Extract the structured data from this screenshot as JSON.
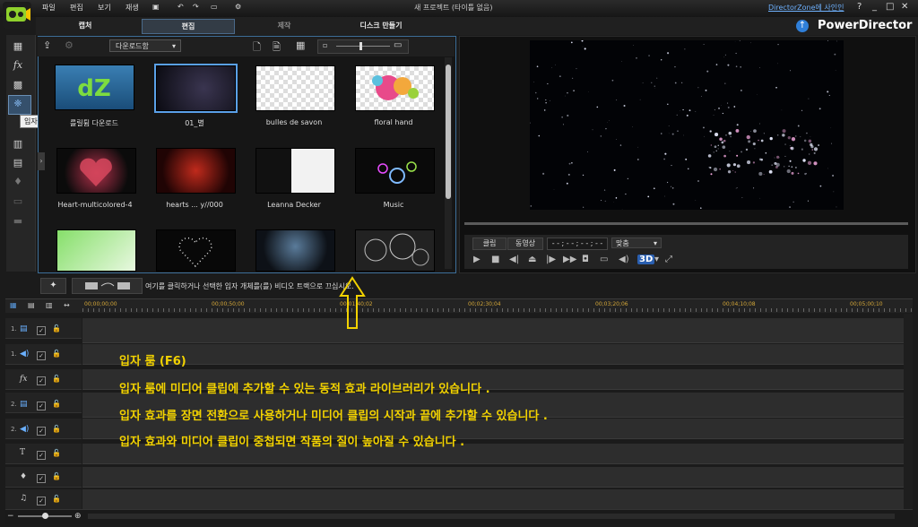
{
  "title_bar": {
    "menu": [
      "파일",
      "편집",
      "보기",
      "재생"
    ],
    "title": "새 프로젝트 (타이틀 없음)",
    "directorzone_link": "DirectorZone에 사인인",
    "help": "?",
    "minimize": "_",
    "restore": "□",
    "close": "✕"
  },
  "mode_tabs": [
    {
      "label": "캡처"
    },
    {
      "label": "편집"
    },
    {
      "label": "제작"
    },
    {
      "label": "디스크 만들기"
    }
  ],
  "brand": "PowerDirector",
  "tooltip": "입자 룸 (F6)",
  "library": {
    "dropdown_value": "다운로드함",
    "items": [
      {
        "label": "를릴튐 다운로드"
      },
      {
        "label": "01_별"
      },
      {
        "label": "bulles de savon"
      },
      {
        "label": "floral hand"
      },
      {
        "label": "Heart-multicolored-4"
      },
      {
        "label": "hearts ... y//000"
      },
      {
        "label": "Leanna Decker"
      },
      {
        "label": "Music"
      },
      {
        "label": ""
      },
      {
        "label": ""
      },
      {
        "label": ""
      },
      {
        "label": ""
      }
    ]
  },
  "preview": {
    "btn_clip": "클립",
    "btn_movie": "동영상",
    "timecode": "- - ; - - ; - - ; - -",
    "fit": "맞춤",
    "three_d": "3D"
  },
  "hint": "여기를 클릭하거나 선택한 입자 개체를(를) 비디오 트랙으로 끄십시오.",
  "timeline": {
    "timecodes": [
      "00;00;00;00",
      "00;00;50;00",
      "00;01;40;02",
      "00;02;30;04",
      "00;03;20;06",
      "00;04;10;08",
      "00;05;00;10"
    ],
    "tracks": [
      {
        "num": "1.",
        "icon": "video"
      },
      {
        "num": "1.",
        "icon": "audio"
      },
      {
        "num": "",
        "icon": "fx"
      },
      {
        "num": "2.",
        "icon": "video"
      },
      {
        "num": "2.",
        "icon": "audio"
      },
      {
        "num": "",
        "icon": "title"
      },
      {
        "num": "",
        "icon": "voice"
      },
      {
        "num": "",
        "icon": "music"
      }
    ]
  },
  "annotation": {
    "line1": "입자 룸 (F6)",
    "line2": "입자 룸에 미디어 클립에 추가할 수 있는 동적 효과 라이브러리가 있습니다 .",
    "line3": "입자 효과를 장면 전환으로 사용하거나 미디어 클립의 시작과 끝에 추가할 수 있습니다 .",
    "line4": "입자 효과와 미디어 클립이 중첩되면 작품의 질이 높아질 수 있습니다 ."
  },
  "colors": {
    "accent": "#3d6f99",
    "annotation": "#f2d200",
    "timecode": "#d3a638"
  }
}
